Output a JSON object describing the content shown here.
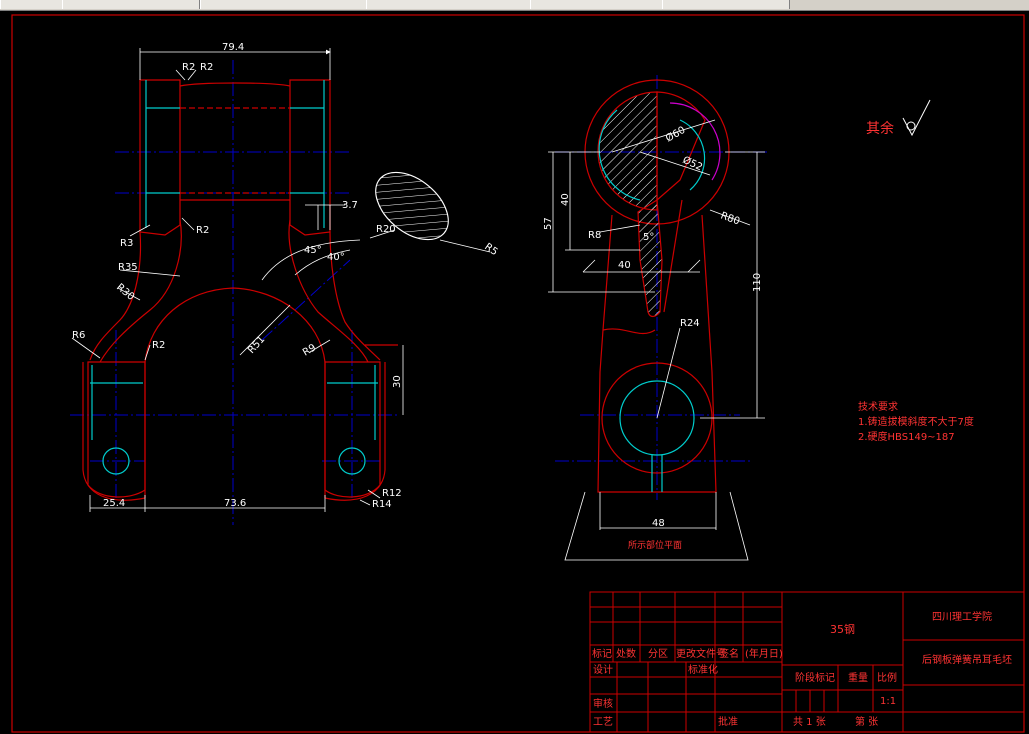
{
  "toolbar": {
    "tabs": [
      "",
      "",
      "",
      "",
      "",
      ""
    ]
  },
  "drawing": {
    "left_view": {
      "dims": {
        "w79_4": "79.4",
        "r2a": "R2",
        "r2b": "R2",
        "r2c": "R2",
        "r2d": "R2",
        "r3": "R3",
        "r35": "R35",
        "r30": "R30",
        "r6": "R6",
        "d3_7": "3.7",
        "a45": "45°",
        "a40": "40°",
        "r20": "R20",
        "r5": "R5",
        "r51": "R51",
        "r9": "R9",
        "d30": "30",
        "d25_4": "25.4",
        "d73_6": "73.6",
        "r12": "R12",
        "r14": "R14"
      }
    },
    "right_view": {
      "dims": {
        "d60": "Ø60",
        "d52": "Ø52",
        "d57": "57",
        "d40v": "40",
        "r8": "R8",
        "a5": "5°",
        "d40h": "40",
        "r80": "R80",
        "d110": "110",
        "r24": "R24",
        "d48": "48",
        "note": "所示部位平面"
      }
    },
    "roughness_label": "其余",
    "tech_req": {
      "title": "技术要求",
      "line1": "1.铸造拔模斜度不大于7度",
      "line2": "2.硬度HBS149~187"
    },
    "title_block": {
      "material": "35钢",
      "school": "四川理工学院",
      "part_name": "后钢板弹簧吊耳毛坯",
      "labels": {
        "mark": "标记",
        "count": "处数",
        "zone": "分区",
        "change_doc": "更改文件号",
        "sign": "签名",
        "date": "(年月日)",
        "design": "设计",
        "standard": "标准化",
        "review": "审核",
        "process": "工艺",
        "approve": "批准",
        "stage": "阶段标记",
        "weight": "重量",
        "scale": "比例",
        "scale_val": "1:1",
        "total": "共 1 张",
        "sheet": "第 张"
      }
    },
    "colors": {
      "outline": "#cc0000",
      "center": "#0000cc",
      "dim": "#ffffff",
      "hatch": "#ffffff",
      "cyan": "#00cccc",
      "magenta": "#cc00cc",
      "text_red": "#ff3333"
    }
  }
}
